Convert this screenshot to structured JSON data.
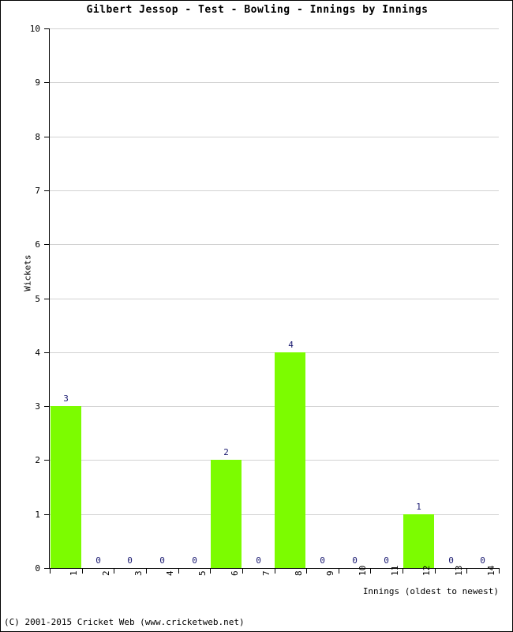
{
  "title": "Gilbert Jessop - Test - Bowling - Innings by Innings",
  "footer": "(C) 2001-2015 Cricket Web (www.cricketweb.net)",
  "colors": {
    "bar": "#7CFC00",
    "bar_label": "#191970",
    "gridline": "#d2d2d2",
    "axis": "#000000",
    "background": "#ffffff"
  },
  "chart_data": {
    "type": "bar",
    "title": "Gilbert Jessop - Test - Bowling - Innings by Innings",
    "xlabel": "Innings (oldest to newest)",
    "ylabel": "Wickets",
    "categories": [
      "1",
      "2",
      "3",
      "4",
      "5",
      "6",
      "7",
      "8",
      "9",
      "10",
      "11",
      "12",
      "13",
      "14"
    ],
    "values": [
      3,
      0,
      0,
      0,
      0,
      2,
      0,
      4,
      0,
      0,
      0,
      1,
      0,
      0
    ],
    "data_labels": [
      "3",
      "0",
      "0",
      "0",
      "0",
      "2",
      "0",
      "4",
      "0",
      "0",
      "0",
      "1",
      "0",
      "0"
    ],
    "ylim": [
      0,
      10
    ],
    "yticks": [
      0,
      1,
      2,
      3,
      4,
      5,
      6,
      7,
      8,
      9,
      10
    ],
    "ytick_labels": [
      "0",
      "1",
      "2",
      "3",
      "4",
      "5",
      "6",
      "7",
      "8",
      "9",
      "10"
    ],
    "grid": true,
    "legend": false,
    "series": [
      {
        "name": "Wickets",
        "values": [
          3,
          0,
          0,
          0,
          0,
          2,
          0,
          4,
          0,
          0,
          0,
          1,
          0,
          0
        ]
      }
    ]
  }
}
